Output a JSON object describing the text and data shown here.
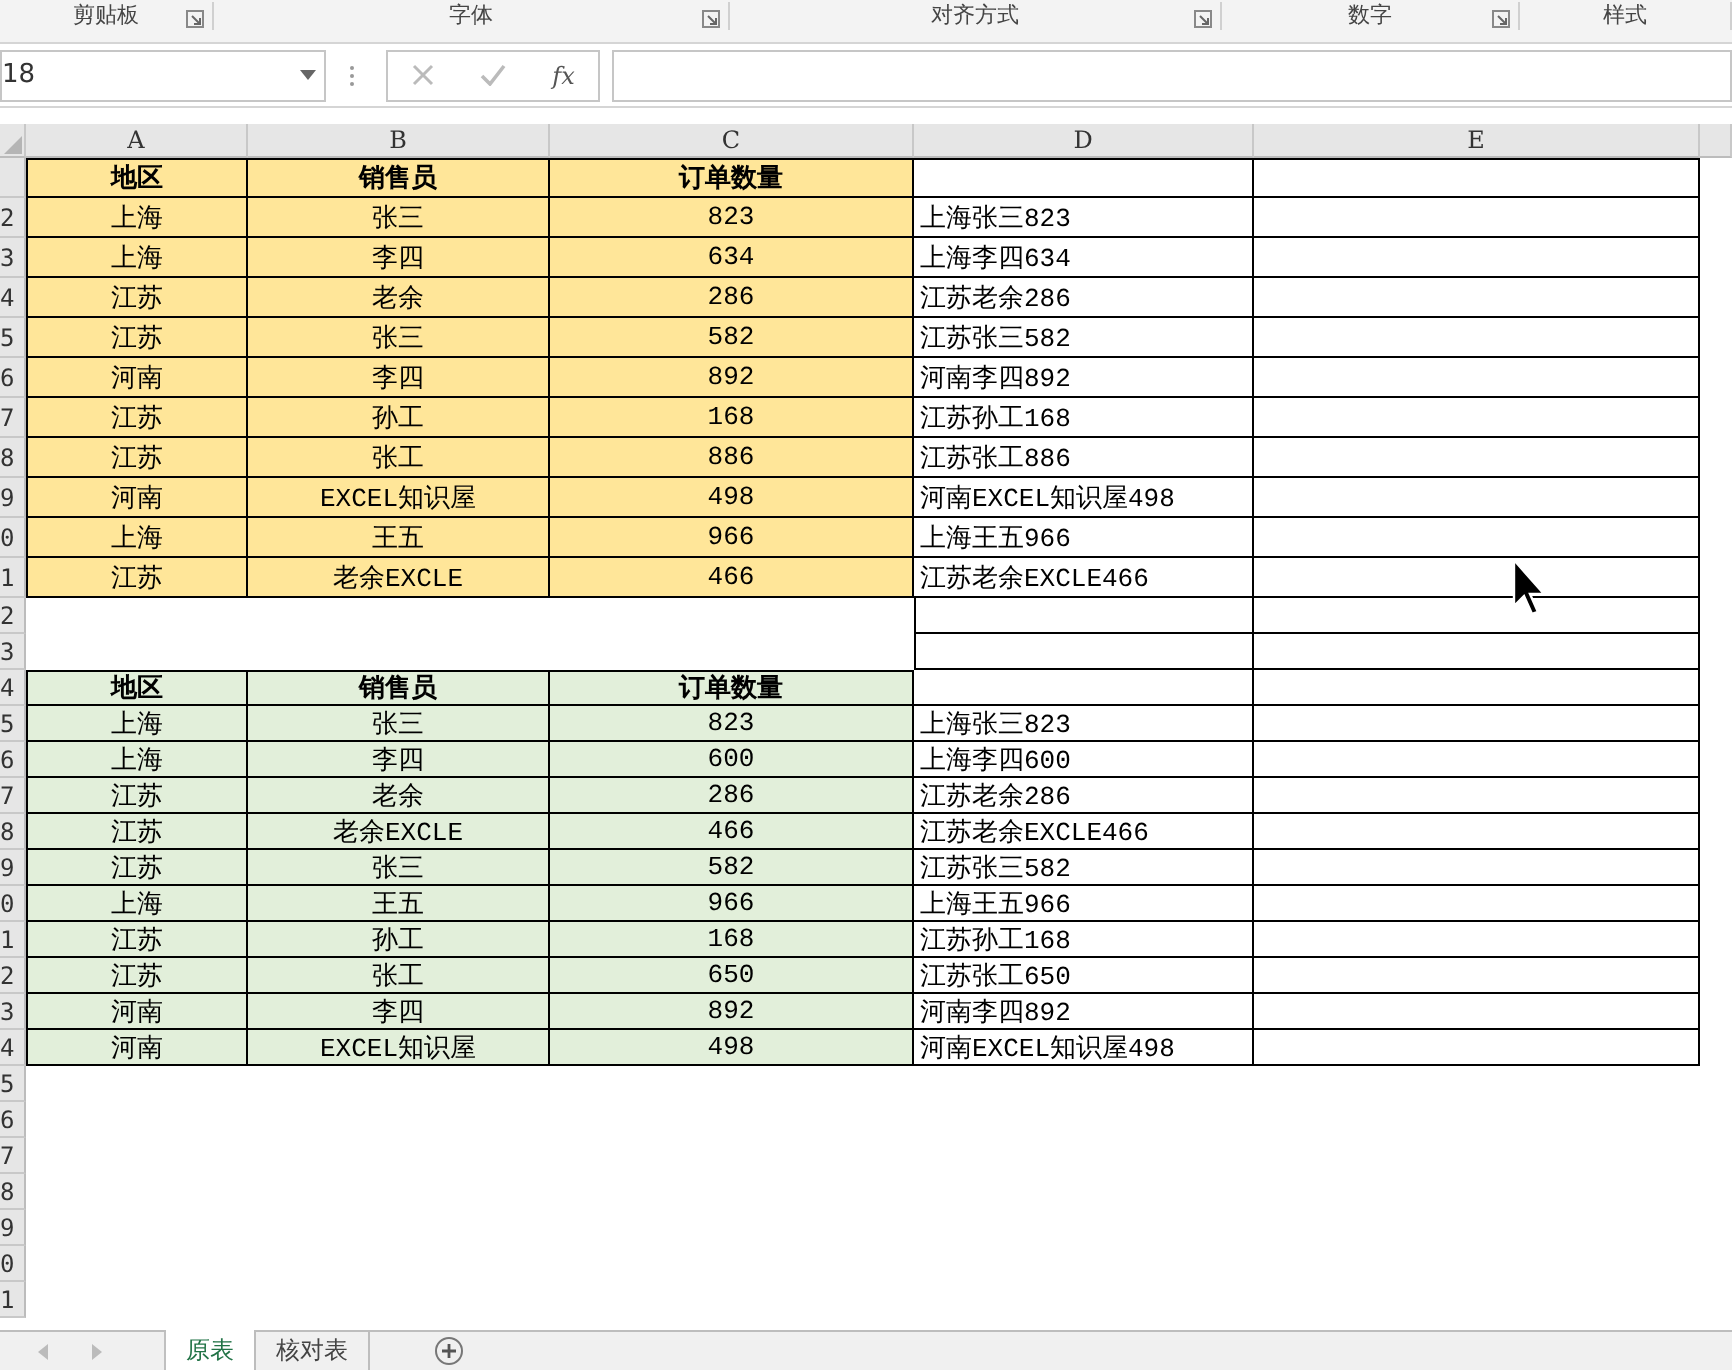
{
  "ribbon": {
    "groups": [
      {
        "label": "剪贴板",
        "launcher": true
      },
      {
        "label": "字体",
        "launcher": true
      },
      {
        "label": "对齐方式",
        "launcher": true
      },
      {
        "label": "数字",
        "launcher": true
      },
      {
        "label": "样式",
        "launcher": false
      }
    ]
  },
  "formula_bar": {
    "name_box": "18",
    "function_button": "fx"
  },
  "sheet": {
    "columns": [
      "A",
      "B",
      "C",
      "D",
      "E"
    ],
    "rows": [
      {
        "kind": "header",
        "color": "#ffe699",
        "cells": {
          "A": "地区",
          "B": "销售员",
          "C": "订单数量"
        }
      },
      {
        "header": "2",
        "kind": "data",
        "color": "#ffe699",
        "cells": {
          "A": "上海",
          "B": "张三",
          "C": "823",
          "D": "上海张三823"
        }
      },
      {
        "header": "3",
        "kind": "data",
        "color": "#ffe699",
        "cells": {
          "A": "上海",
          "B": "李四",
          "C": "634",
          "D": "上海李四634"
        }
      },
      {
        "header": "4",
        "kind": "data",
        "color": "#ffe699",
        "cells": {
          "A": "江苏",
          "B": "老余",
          "C": "286",
          "D": "江苏老余286"
        }
      },
      {
        "header": "5",
        "kind": "data",
        "color": "#ffe699",
        "cells": {
          "A": "江苏",
          "B": "张三",
          "C": "582",
          "D": "江苏张三582"
        }
      },
      {
        "header": "6",
        "kind": "data",
        "color": "#ffe699",
        "cells": {
          "A": "河南",
          "B": "李四",
          "C": "892",
          "D": "河南李四892"
        }
      },
      {
        "header": "7",
        "kind": "data",
        "color": "#ffe699",
        "cells": {
          "A": "江苏",
          "B": "孙工",
          "C": "168",
          "D": "江苏孙工168"
        }
      },
      {
        "header": "8",
        "kind": "data",
        "color": "#ffe699",
        "cells": {
          "A": "江苏",
          "B": "张工",
          "C": "886",
          "D": "江苏张工886"
        }
      },
      {
        "header": "9",
        "kind": "data",
        "color": "#ffe699",
        "cells": {
          "A": "河南",
          "B": "EXCEL知识屋",
          "C": "498",
          "D": "河南EXCEL知识屋498"
        }
      },
      {
        "header": "0",
        "kind": "data",
        "color": "#ffe699",
        "cells": {
          "A": "上海",
          "B": "王五",
          "C": "966",
          "D": "上海王五966"
        }
      },
      {
        "header": "1",
        "kind": "data",
        "color": "#ffe699",
        "cells": {
          "A": "江苏",
          "B": "老余EXCLE",
          "C": "466",
          "D": "江苏老余EXCLE466"
        }
      },
      {
        "header": "2",
        "kind": "spacer",
        "cells": {}
      },
      {
        "header": "3",
        "kind": "spacer",
        "cells": {}
      },
      {
        "header": "4",
        "kind": "header",
        "color": "#e2efda",
        "cells": {
          "A": "地区",
          "B": "销售员",
          "C": "订单数量"
        }
      },
      {
        "header": "5",
        "kind": "data",
        "color": "#e2efda",
        "cells": {
          "A": "上海",
          "B": "张三",
          "C": "823",
          "D": "上海张三823"
        }
      },
      {
        "header": "6",
        "kind": "data",
        "color": "#e2efda",
        "cells": {
          "A": "上海",
          "B": "李四",
          "C": "600",
          "D": "上海李四600"
        }
      },
      {
        "header": "7",
        "kind": "data",
        "color": "#e2efda",
        "cells": {
          "A": "江苏",
          "B": "老余",
          "C": "286",
          "D": "江苏老余286"
        }
      },
      {
        "header": "8",
        "kind": "data",
        "color": "#e2efda",
        "cells": {
          "A": "江苏",
          "B": "老余EXCLE",
          "C": "466",
          "D": "江苏老余EXCLE466"
        }
      },
      {
        "header": "9",
        "kind": "data",
        "color": "#e2efda",
        "cells": {
          "A": "江苏",
          "B": "张三",
          "C": "582",
          "D": "江苏张三582"
        }
      },
      {
        "header": "0",
        "kind": "data",
        "color": "#e2efda",
        "cells": {
          "A": "上海",
          "B": "王五",
          "C": "966",
          "D": "上海王五966"
        }
      },
      {
        "header": "1",
        "kind": "data",
        "color": "#e2efda",
        "cells": {
          "A": "江苏",
          "B": "孙工",
          "C": "168",
          "D": "江苏孙工168"
        }
      },
      {
        "header": "2",
        "kind": "data",
        "color": "#e2efda",
        "cells": {
          "A": "江苏",
          "B": "张工",
          "C": "650",
          "D": "江苏张工650"
        }
      },
      {
        "header": "3",
        "kind": "data",
        "color": "#e2efda",
        "cells": {
          "A": "河南",
          "B": "李四",
          "C": "892",
          "D": "河南李四892"
        }
      },
      {
        "header": "4",
        "kind": "data",
        "color": "#e2efda",
        "cells": {
          "A": "河南",
          "B": "EXCEL知识屋",
          "C": "498",
          "D": "河南EXCEL知识屋498"
        }
      },
      {
        "header": "5",
        "kind": "empty",
        "cells": {}
      },
      {
        "header": "6",
        "kind": "empty",
        "cells": {}
      },
      {
        "header": "7",
        "kind": "empty",
        "cells": {}
      },
      {
        "header": "8",
        "kind": "empty",
        "cells": {}
      },
      {
        "header": "9",
        "kind": "empty",
        "cells": {}
      },
      {
        "header": "0",
        "kind": "empty",
        "cells": {}
      },
      {
        "header": "1",
        "kind": "empty",
        "cells": {}
      }
    ]
  },
  "sheet_tabs": [
    {
      "label": "原表",
      "selected": true
    },
    {
      "label": "核对表",
      "selected": false
    }
  ]
}
